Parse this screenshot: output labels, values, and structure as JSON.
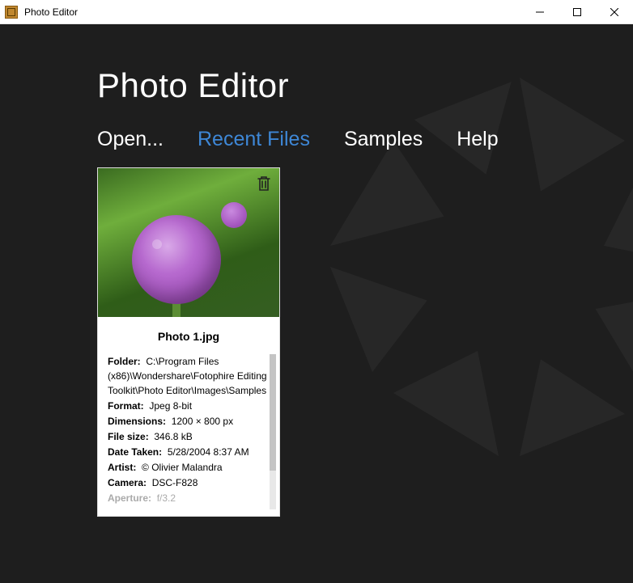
{
  "window": {
    "title": "Photo Editor"
  },
  "app": {
    "title": "Photo Editor"
  },
  "tabs": {
    "open": "Open...",
    "recent": "Recent Files",
    "samples": "Samples",
    "help": "Help",
    "active": "recent"
  },
  "recent": [
    {
      "filename": "Photo 1.jpg",
      "meta": {
        "folder_label": "Folder:",
        "folder_value": "C:\\Program Files (x86)\\Wondershare\\Fotophire Editing Toolkit\\Photo Editor\\Images\\Samples",
        "format_label": "Format:",
        "format_value": "Jpeg 8-bit",
        "dimensions_label": "Dimensions:",
        "dimensions_value": "1200 × 800 px",
        "filesize_label": "File size:",
        "filesize_value": "346.8 kB",
        "date_label": "Date Taken:",
        "date_value": "5/28/2004 8:37 AM",
        "artist_label": "Artist:",
        "artist_value": "© Olivier Malandra",
        "camera_label": "Camera:",
        "camera_value": "DSC-F828",
        "aperture_label": "Aperture:",
        "aperture_value": "f/3.2"
      }
    }
  ]
}
